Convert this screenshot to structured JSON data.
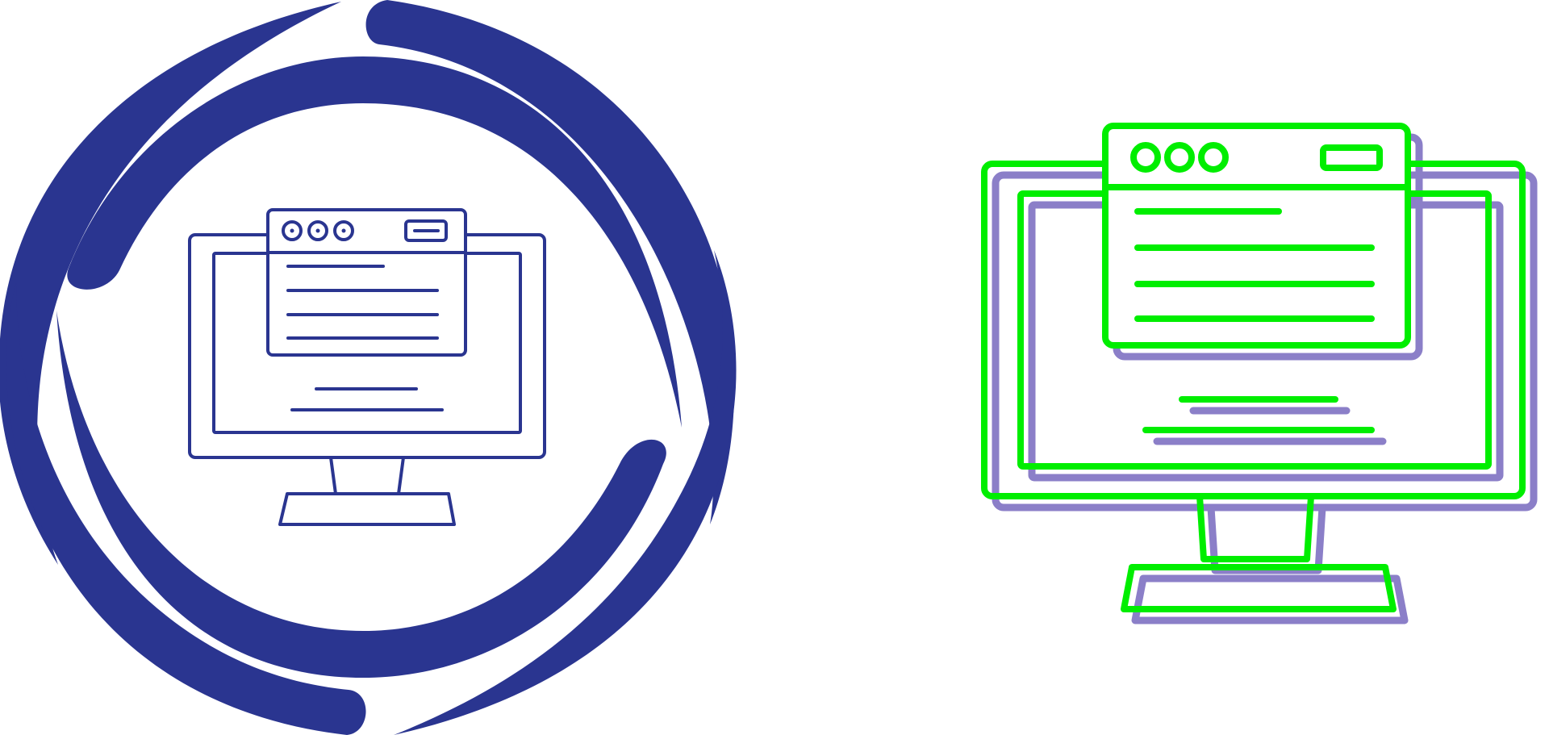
{
  "icons": [
    {
      "name": "monitor-web-page-circular-icon",
      "style": "glyph-with-circular-arrows",
      "colors": {
        "primary": "#2a3590",
        "background": "#ffffff"
      }
    },
    {
      "name": "monitor-web-page-offset-outline-icon",
      "style": "offset-outline",
      "colors": {
        "outline": "#00ee00",
        "shadow": "#8b7fc8",
        "background": "#ffffff"
      }
    }
  ]
}
